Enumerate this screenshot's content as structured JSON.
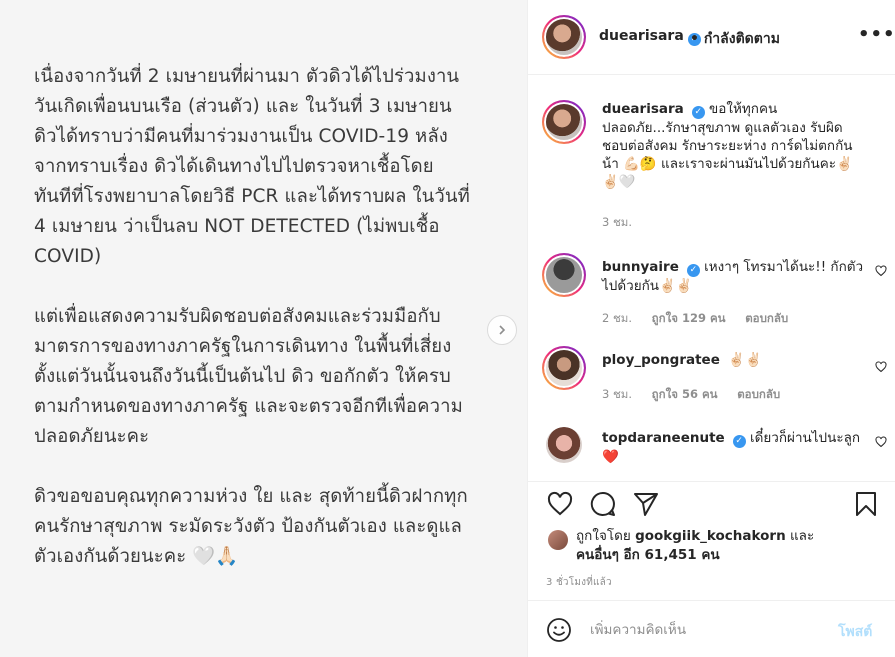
{
  "media": {
    "paragraphs": [
      "เนื่องจากวันที่ 2 เมษายนที่ผ่านมา ตัวดิวได้ไปร่วมงาน\nวันเกิดเพื่อนบนเรือ (ส่วนตัว) และ ในวันที่ 3 เมษายน\nดิวได้ทราบว่ามีคนที่มาร่วมงานเป็น COVID-19 หลัง\nจากทราบเรื่อง ดิวได้เดินทางไปไปตรวจหาเชื้อโดย\nทันทีที่โรงพยาบาลโดยวิธี PCR และได้ทราบผล ในวันที่\n4 เมษายน ว่าเป็นลบ NOT DETECTED (ไม่พบเชื้อ\nCOVID)",
      "แต่เพื่อแสดงความรับผิดชอบต่อสังคมและร่วมมือกับ\nมาตรการของทางภาครัฐในการเดินทาง ในพื้นที่เสี่ยง\nตั้งแต่วันนั้นจนถึงวันนี้เป็นต้นไป ดิว ขอกักตัว ให้ครบ\nตามกำหนดของทางภาครัฐ และจะตรวจอีกทีเพื่อความ\nปลอดภัยนะคะ",
      "ดิวขอขอบคุณทุกความห่วง ใย และ สุดท้ายนี้ดิวฝากทุก\nคนรักษาสุขภาพ ระมัดระวังตัว ป้องกันตัวเอง และดูแล\nตัวเองกันด้วยนะคะ 🤍🙏🏻"
    ]
  },
  "header": {
    "username": "duearisara",
    "separator": "•",
    "follow_state": "กำลังติดตาม",
    "more": "•••"
  },
  "caption": {
    "username": "duearisara",
    "text": "ขอให้ทุกคนปลอดภัย...รักษาสุขภาพ ดูแลตัวเอง รับผิดชอบต่อสังคม รักษาระยะห่าง การ์ดไม่ตกกันน้า 💪🏻🤔 และเราจะผ่านมันไปด้วยกันคะ✌🏻✌🏻🤍",
    "time": "3 ชม."
  },
  "comments": [
    {
      "username": "bunnyaire",
      "text": "เหงาๆ โทรมาได้นะ!! กักตัวไปด้วยกัน✌🏻✌🏻",
      "time": "2 ชม.",
      "likes": "ถูกใจ 129 คน",
      "reply": "ตอบกลับ"
    },
    {
      "username": "ploy_pongratee",
      "text": "✌🏻✌🏻",
      "time": "3 ชม.",
      "likes": "ถูกใจ 56 คน",
      "reply": "ตอบกลับ"
    },
    {
      "username": "topdaraneenute",
      "text": "เดี๋ยวก็ผ่านไปนะลูก❤️",
      "time": "",
      "likes": "",
      "reply": ""
    }
  ],
  "likes": {
    "prefix": "ถูกใจโดย",
    "user": "gookgiik_kochakorn",
    "and": "และ",
    "others": "คนอื่นๆ อีก 61,451 คน"
  },
  "time_ago": "3 ชั่วโมงที่แล้ว",
  "comment_box": {
    "placeholder": "เพิ่มความคิดเห็น",
    "post_label": "โพสต์"
  },
  "colors": {
    "verified": "#3897f0",
    "post_disabled": "#b2dffc",
    "heart_red": "#ed4956"
  }
}
